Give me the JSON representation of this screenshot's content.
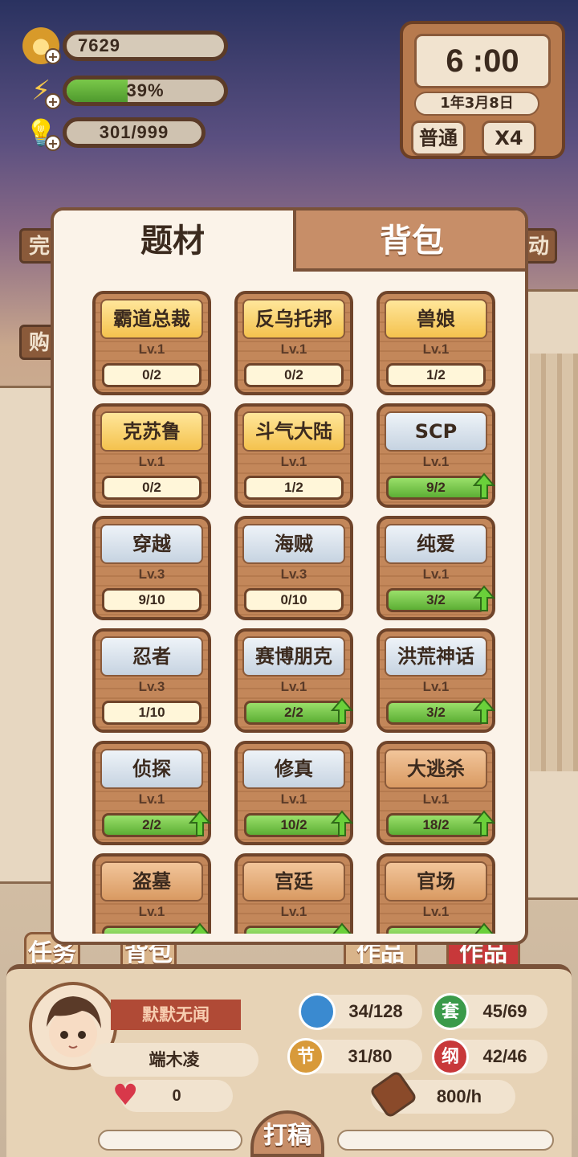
{
  "resources": {
    "coins": "7629",
    "energy": "39%",
    "energy_level": 0.39,
    "inspiration": "301/999"
  },
  "clock": {
    "time": "6 :00",
    "date": "1年3月8日",
    "mode": "普通",
    "speed": "X4"
  },
  "side_signs": {
    "left_top": "完",
    "left_mid": "购",
    "right_top": "动"
  },
  "modal": {
    "tab_active": "题材",
    "tab_inactive": "背包",
    "cards": [
      {
        "name": "霸道总裁",
        "level": "Lv.1",
        "progress": "0/2",
        "style": "gold",
        "upgradable": false
      },
      {
        "name": "反乌托邦",
        "level": "Lv.1",
        "progress": "0/2",
        "style": "gold",
        "upgradable": false
      },
      {
        "name": "兽娘",
        "level": "Lv.1",
        "progress": "1/2",
        "style": "gold",
        "upgradable": false
      },
      {
        "name": "克苏鲁",
        "level": "Lv.1",
        "progress": "0/2",
        "style": "gold",
        "upgradable": false
      },
      {
        "name": "斗气大陆",
        "level": "Lv.1",
        "progress": "1/2",
        "style": "gold",
        "upgradable": false
      },
      {
        "name": "SCP",
        "level": "Lv.1",
        "progress": "9/2",
        "style": "silver",
        "upgradable": true
      },
      {
        "name": "穿越",
        "level": "Lv.3",
        "progress": "9/10",
        "style": "silver",
        "upgradable": false
      },
      {
        "name": "海贼",
        "level": "Lv.3",
        "progress": "0/10",
        "style": "silver",
        "upgradable": false
      },
      {
        "name": "纯爱",
        "level": "Lv.1",
        "progress": "3/2",
        "style": "silver",
        "upgradable": true
      },
      {
        "name": "忍者",
        "level": "Lv.3",
        "progress": "1/10",
        "style": "silver",
        "upgradable": false
      },
      {
        "name": "赛博朋克",
        "level": "Lv.1",
        "progress": "2/2",
        "style": "silver",
        "upgradable": true
      },
      {
        "name": "洪荒神话",
        "level": "Lv.1",
        "progress": "3/2",
        "style": "silver",
        "upgradable": true
      },
      {
        "name": "侦探",
        "level": "Lv.1",
        "progress": "2/2",
        "style": "silver",
        "upgradable": true
      },
      {
        "name": "修真",
        "level": "Lv.1",
        "progress": "10/2",
        "style": "silver",
        "upgradable": true
      },
      {
        "name": "大逃杀",
        "level": "Lv.1",
        "progress": "18/2",
        "style": "bronze",
        "upgradable": true
      },
      {
        "name": "盗墓",
        "level": "Lv.1",
        "progress": "",
        "style": "bronze",
        "upgradable": true
      },
      {
        "name": "宫廷",
        "level": "Lv.1",
        "progress": "",
        "style": "bronze",
        "upgradable": true
      },
      {
        "name": "官场",
        "level": "Lv.1",
        "progress": "",
        "style": "bronze",
        "upgradable": true
      }
    ]
  },
  "bottom_tabs": {
    "task": "任务",
    "backpack": "背包",
    "works1": "作品",
    "works2": "作品"
  },
  "player": {
    "title": "默默无闻",
    "name": "端木凌",
    "likes": "0",
    "rate": "800/h",
    "write_button": "打稿"
  },
  "stats": [
    {
      "icon": "",
      "value": "34/128",
      "color": "#3a8ad0"
    },
    {
      "icon": "套",
      "value": "45/69",
      "color": "#3a9a4a"
    },
    {
      "icon": "节",
      "value": "31/80",
      "color": "#d89a3a"
    },
    {
      "icon": "纲",
      "value": "42/46",
      "color": "#c8383a"
    }
  ],
  "colors": {
    "frame": "#7a5239",
    "accent_orange": "#e86a2a",
    "upgrade_green": "#5cae34"
  }
}
